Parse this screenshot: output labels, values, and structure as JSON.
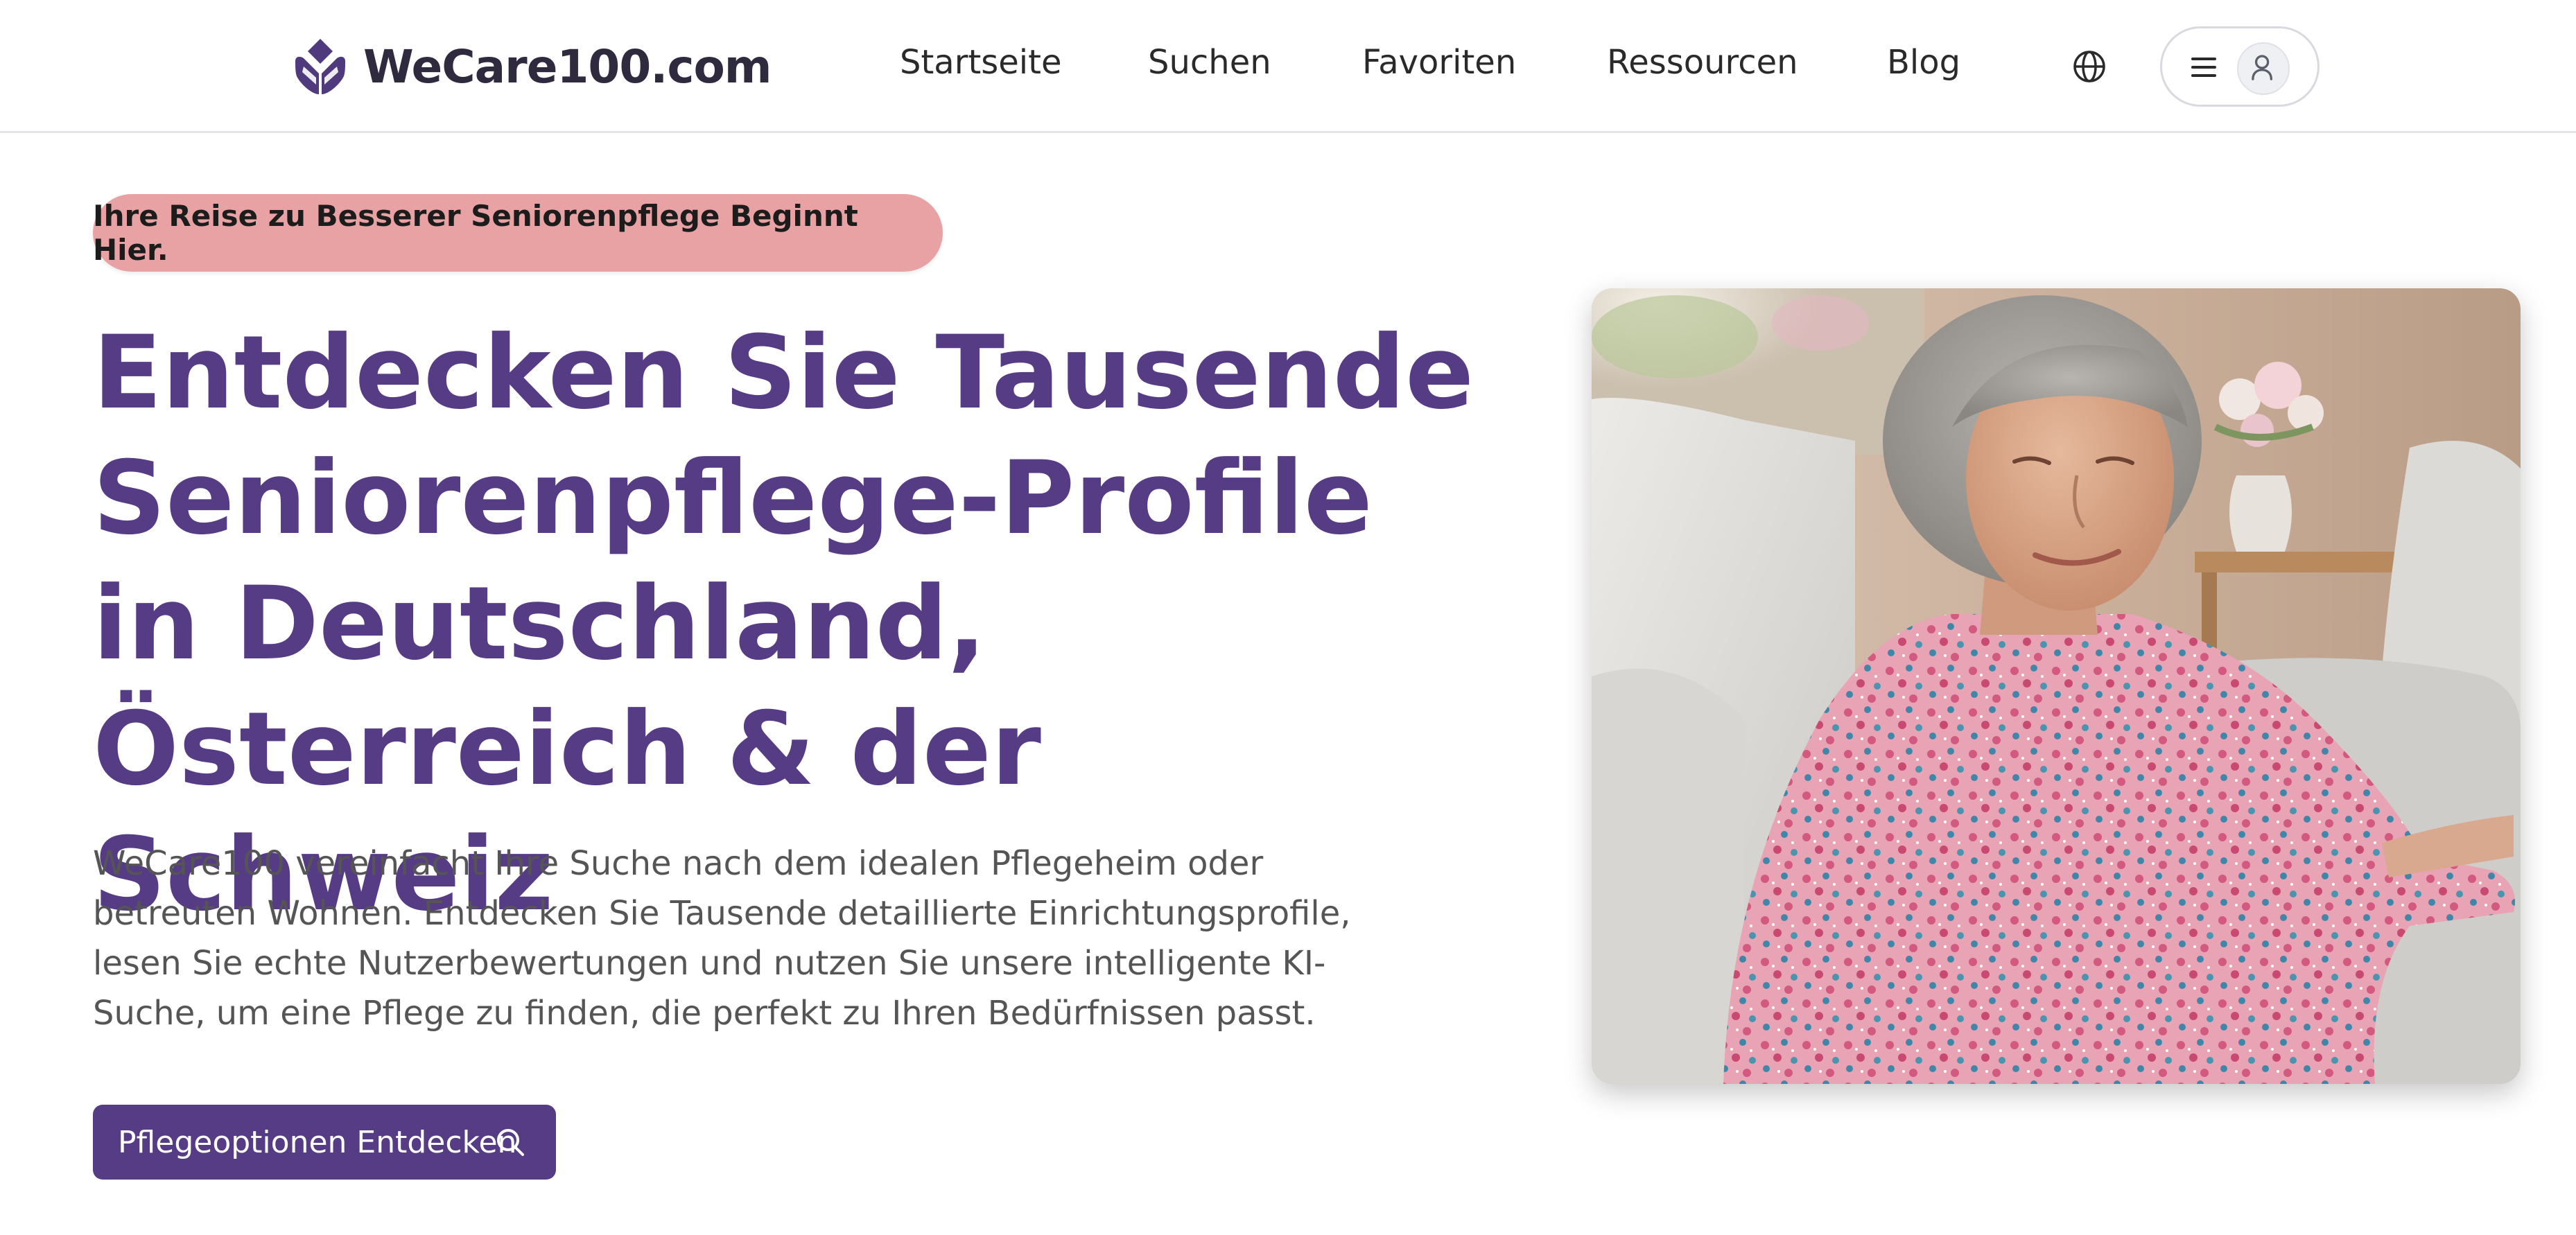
{
  "header": {
    "logo_text": "WeCare100.com",
    "nav": [
      {
        "label": "Startseite"
      },
      {
        "label": "Suchen"
      },
      {
        "label": "Favoriten"
      },
      {
        "label": "Ressourcen"
      },
      {
        "label": "Blog"
      }
    ],
    "language_icon": "globe-icon",
    "menu_icon": "hamburger-icon",
    "user_icon": "user-icon"
  },
  "hero": {
    "badge": "Ihre Reise zu Besserer Seniorenpflege Beginnt Hier.",
    "title": "Entdecken Sie Tausende Seniorenpflege-Profile in Deutschland, Österreich & der Schweiz",
    "description": "WeCare100 vereinfacht Ihre Suche nach dem idealen Pflegeheim oder betreuten Wohnen. Entdecken Sie Tausende detaillierte Einrichtungsprofile, lesen Sie echte Nutzerbewertungen und nutzen Sie unsere intelligente KI-Suche, um eine Pflege zu finden, die perfekt zu Ihren Bedürfnissen passt.",
    "cta_label": "Pflegeoptionen Entdecken",
    "cta_icon": "search-icon"
  },
  "colors": {
    "brand_purple": "#553c85",
    "badge_pink": "#e8a2a4",
    "logo_dark": "#2f2a3d"
  }
}
